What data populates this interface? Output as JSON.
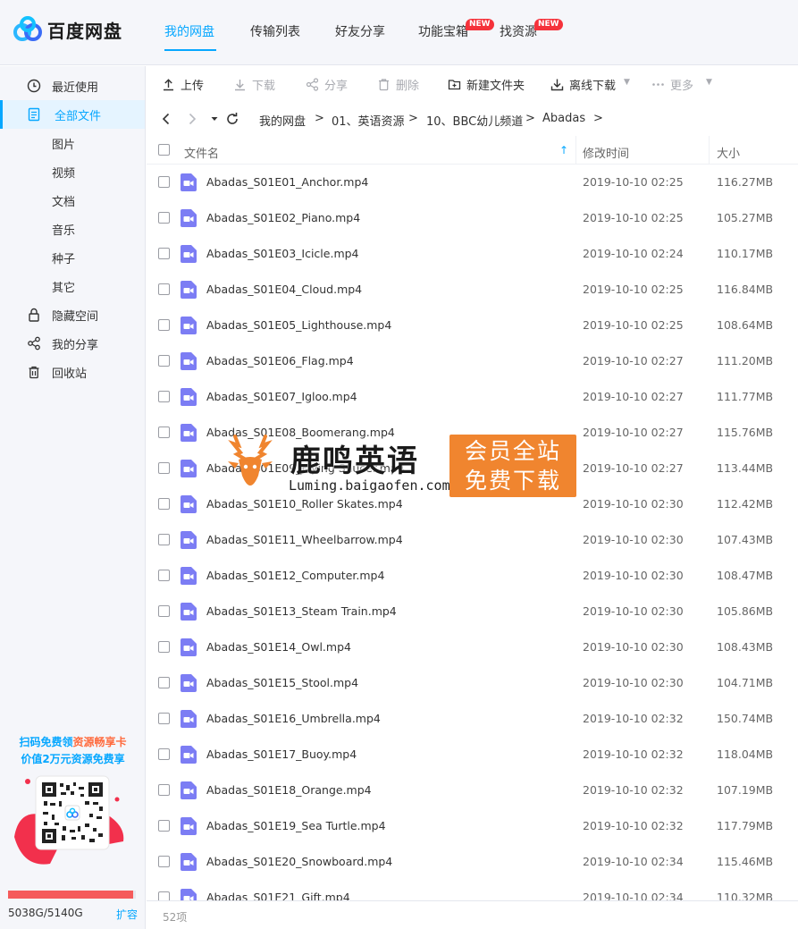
{
  "app": {
    "name": "百度网盘"
  },
  "nav": {
    "tabs": [
      {
        "label": "我的网盘"
      },
      {
        "label": "传输列表"
      },
      {
        "label": "好友分享"
      },
      {
        "label": "功能宝箱",
        "badge": "NEW"
      },
      {
        "label": "找资源",
        "badge": "NEW"
      }
    ]
  },
  "sidebar": {
    "items": [
      {
        "label": "最近使用",
        "icon": "clock-icon"
      },
      {
        "label": "全部文件",
        "icon": "document-icon"
      },
      {
        "label": "图片"
      },
      {
        "label": "视频"
      },
      {
        "label": "文档"
      },
      {
        "label": "音乐"
      },
      {
        "label": "种子"
      },
      {
        "label": "其它"
      },
      {
        "label": "隐藏空间",
        "icon": "lock-icon"
      },
      {
        "label": "我的分享",
        "icon": "share-icon"
      },
      {
        "label": "回收站",
        "icon": "trash-icon"
      }
    ],
    "promo": {
      "line1_a": "扫码免费领",
      "line1_b": "资源畅享卡",
      "line2": "价值2万元资源免费享"
    },
    "quota": {
      "text": "5038G/5140G",
      "used_fraction": 0.98,
      "expand": "扩容"
    }
  },
  "toolbar": {
    "upload": "上传",
    "download": "下载",
    "share": "分享",
    "delete": "删除",
    "new_folder": "新建文件夹",
    "offline_download": "离线下载",
    "more": "更多"
  },
  "breadcrumb": [
    "我的网盘",
    "01、英语资源",
    "10、BBC幼儿频道",
    "Abadas"
  ],
  "table": {
    "headers": {
      "name": "文件名",
      "modified": "修改时间",
      "size": "大小"
    },
    "rows": [
      {
        "name": "Abadas_S01E01_Anchor.mp4",
        "modified": "2019-10-10 02:25",
        "size": "116.27MB"
      },
      {
        "name": "Abadas_S01E02_Piano.mp4",
        "modified": "2019-10-10 02:25",
        "size": "105.27MB"
      },
      {
        "name": "Abadas_S01E03_Icicle.mp4",
        "modified": "2019-10-10 02:24",
        "size": "110.17MB"
      },
      {
        "name": "Abadas_S01E04_Cloud.mp4",
        "modified": "2019-10-10 02:25",
        "size": "116.84MB"
      },
      {
        "name": "Abadas_S01E05_Lighthouse.mp4",
        "modified": "2019-10-10 02:25",
        "size": "108.64MB"
      },
      {
        "name": "Abadas_S01E06_Flag.mp4",
        "modified": "2019-10-10 02:27",
        "size": "111.20MB"
      },
      {
        "name": "Abadas_S01E07_Igloo.mp4",
        "modified": "2019-10-10 02:27",
        "size": "111.77MB"
      },
      {
        "name": "Abadas_S01E08_Boomerang.mp4",
        "modified": "2019-10-10 02:27",
        "size": "115.76MB"
      },
      {
        "name": "Abadas_S01E09_Flying Saucer.mp4",
        "modified": "2019-10-10 02:27",
        "size": "113.44MB"
      },
      {
        "name": "Abadas_S01E10_Roller Skates.mp4",
        "modified": "2019-10-10 02:30",
        "size": "112.42MB"
      },
      {
        "name": "Abadas_S01E11_Wheelbarrow.mp4",
        "modified": "2019-10-10 02:30",
        "size": "107.43MB"
      },
      {
        "name": "Abadas_S01E12_Computer.mp4",
        "modified": "2019-10-10 02:30",
        "size": "108.47MB"
      },
      {
        "name": "Abadas_S01E13_Steam Train.mp4",
        "modified": "2019-10-10 02:30",
        "size": "105.86MB"
      },
      {
        "name": "Abadas_S01E14_Owl.mp4",
        "modified": "2019-10-10 02:30",
        "size": "108.43MB"
      },
      {
        "name": "Abadas_S01E15_Stool.mp4",
        "modified": "2019-10-10 02:30",
        "size": "104.71MB"
      },
      {
        "name": "Abadas_S01E16_Umbrella.mp4",
        "modified": "2019-10-10 02:32",
        "size": "150.74MB"
      },
      {
        "name": "Abadas_S01E17_Buoy.mp4",
        "modified": "2019-10-10 02:32",
        "size": "118.04MB"
      },
      {
        "name": "Abadas_S01E18_Orange.mp4",
        "modified": "2019-10-10 02:32",
        "size": "107.19MB"
      },
      {
        "name": "Abadas_S01E19_Sea Turtle.mp4",
        "modified": "2019-10-10 02:32",
        "size": "117.79MB"
      },
      {
        "name": "Abadas_S01E20_Snowboard.mp4",
        "modified": "2019-10-10 02:34",
        "size": "115.46MB"
      },
      {
        "name": "Abadas_S01E21_Gift.mp4",
        "modified": "2019-10-10 02:34",
        "size": "110.32MB"
      }
    ]
  },
  "footer": {
    "count": "52项"
  },
  "watermark": {
    "title": "鹿鸣英语",
    "url": "Luming.baigaofen.com",
    "badge_line1": "会员全站",
    "badge_line2": "免费下载"
  },
  "colors": {
    "accent": "#06a7ff",
    "video_icon": "#7c7df4",
    "badge": "#f5323b",
    "watermark": "#f0852f"
  }
}
